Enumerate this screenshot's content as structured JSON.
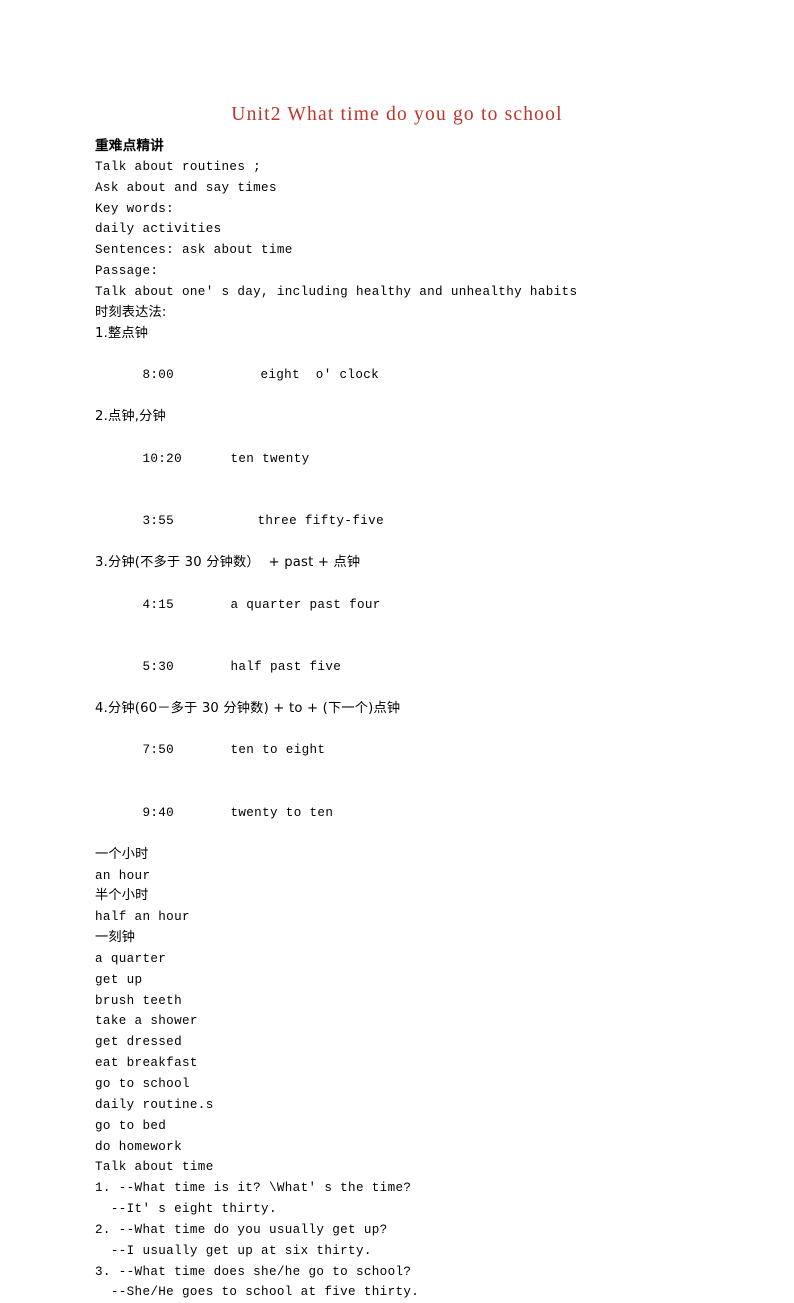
{
  "document": {
    "title": "Unit2 What time do you go to school",
    "title_color": "#c0342b",
    "heading": "重难点精讲",
    "objectives": [
      "Talk about routines ;",
      "Ask about and say times",
      "Key words:",
      "daily activities",
      "Sentences: ask about time",
      "Passage:",
      "Talk about one' s day, including healthy and unhealthy habits"
    ],
    "time_section_heading": "时刻表达法:",
    "rules": [
      {
        "label": "1.整点钟",
        "rows": [
          {
            "clock": "8:00",
            "reading": "eight  o' clock",
            "indent": 118
          }
        ]
      },
      {
        "label": "2.点钟,分钟",
        "rows": [
          {
            "clock": "10:20",
            "reading": "ten twenty",
            "indent": 88
          },
          {
            "clock": "3:55",
            "reading": "three fifty-five",
            "indent": 115
          }
        ]
      },
      {
        "label": "3.分钟(不多于 30 分钟数）  + past + 点钟",
        "rows": [
          {
            "clock": "4:15",
            "reading": "a quarter past four",
            "indent": 88
          },
          {
            "clock": "5:30",
            "reading": "half past five",
            "indent": 88
          }
        ]
      },
      {
        "label": "4.分钟(60－多于 30 分钟数) + to + (下一个)点钟",
        "rows": [
          {
            "clock": "7:50",
            "reading": "ten to eight",
            "indent": 88
          },
          {
            "clock": "9:40",
            "reading": "twenty to ten",
            "indent": 88
          }
        ]
      }
    ],
    "duration_terms": [
      {
        "cn": "一个小时",
        "en": "an hour"
      },
      {
        "cn": "半个小时",
        "en": "half an hour"
      },
      {
        "cn": "一刻钟",
        "en": "a quarter"
      }
    ],
    "vocabulary": [
      "get up",
      "brush teeth",
      "take a shower",
      "get dressed",
      "eat breakfast",
      "go to school",
      "daily routine.s",
      "go to bed",
      "do homework"
    ],
    "dialog_heading": "Talk about time",
    "dialogs": [
      {
        "question": "1. --What time is it? \\What' s the time?",
        "answer": "  --It' s eight thirty."
      },
      {
        "question": "2. --What time do you usually get up?",
        "answer": "  --I usually get up at six thirty."
      },
      {
        "question": "3. --What time does she/he go to school?",
        "answer": "  --She/He goes to school at five thirty."
      }
    ]
  }
}
